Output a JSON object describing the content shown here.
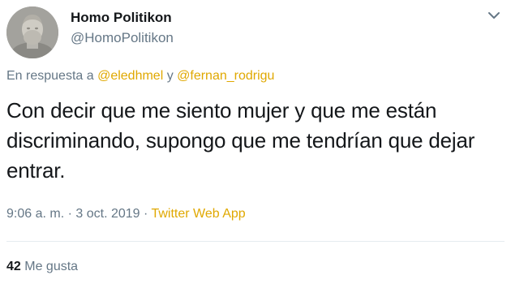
{
  "author": {
    "display_name": "Homo Politikon",
    "handle": "@HomoPolitikon",
    "avatar_icon": "bust-portrait-avatar"
  },
  "reply_context": {
    "prefix": "En respuesta a ",
    "mention_1": "@eledhmel",
    "joiner": " y ",
    "mention_2": "@fernan_rodrigu"
  },
  "tweet": {
    "text": "Con decir que me siento mujer y que me están discriminando, supongo que me tendrían que dejar entrar."
  },
  "meta": {
    "time": "9:06 a. m.",
    "sep_1": " · ",
    "date": "3 oct. 2019",
    "sep_2": " · ",
    "source": "Twitter Web App"
  },
  "stats": {
    "likes_count": "42",
    "likes_label": " Me gusta"
  },
  "colors": {
    "link": "#e0a800",
    "secondary_text": "#657786",
    "primary_text": "#14171a"
  }
}
